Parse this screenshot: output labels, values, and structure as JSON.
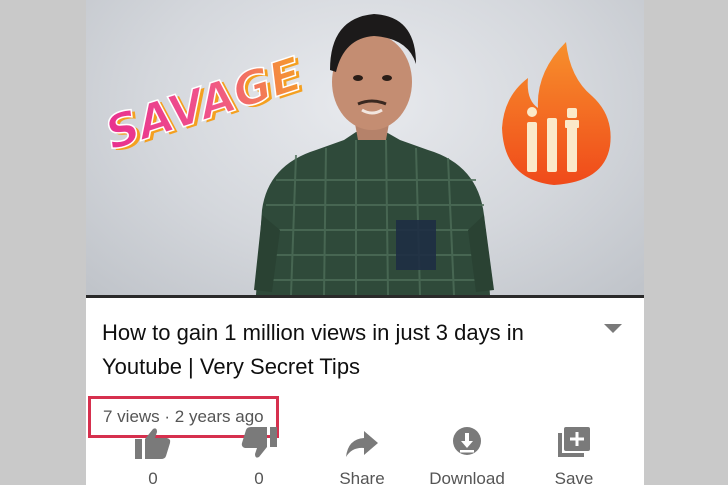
{
  "video": {
    "title": "How to gain 1 million views in just 3 days in Youtube | Very Secret Tips",
    "meta": "7 views · 2 years ago",
    "thumbnail": {
      "text_left": "SAVAGE",
      "text_right": "lit",
      "accent_colors": [
        "#e8308f",
        "#f59a2a",
        "#f4511e"
      ]
    }
  },
  "actions": [
    {
      "name": "like",
      "icon": "thumbs-up-icon",
      "label": "0"
    },
    {
      "name": "dislike",
      "icon": "thumbs-down-icon",
      "label": "0"
    },
    {
      "name": "share",
      "icon": "share-icon",
      "label": "Share"
    },
    {
      "name": "download",
      "icon": "download-icon",
      "label": "Download"
    },
    {
      "name": "save",
      "icon": "playlist-add-icon",
      "label": "Save"
    }
  ],
  "colors": {
    "highlight_box": "#d6304e",
    "icon_gray": "#7a7a7a"
  }
}
